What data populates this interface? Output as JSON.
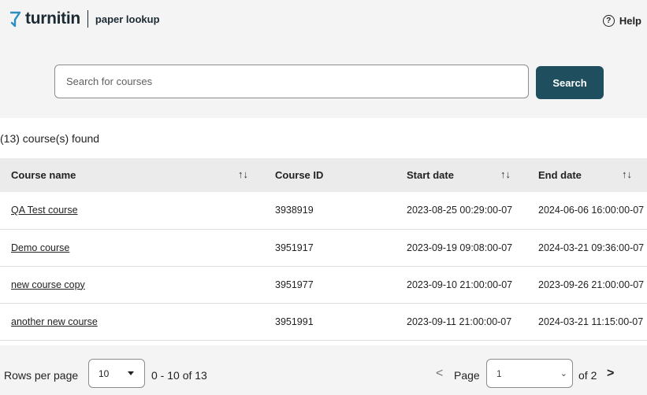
{
  "header": {
    "brand_name": "turnitin",
    "product_name": "paper lookup",
    "help_label": "Help",
    "help_icon": "question-circle-icon"
  },
  "search": {
    "placeholder": "Search for courses",
    "value": "",
    "button_label": "Search"
  },
  "results": {
    "count_text": "(13) course(s) found"
  },
  "table": {
    "columns": [
      {
        "label": "Course name",
        "sortable": true
      },
      {
        "label": "Course ID",
        "sortable": false
      },
      {
        "label": "Start date",
        "sortable": true
      },
      {
        "label": "End date",
        "sortable": true
      }
    ],
    "sort_glyph": "↑↓",
    "rows": [
      {
        "name": "QA Test course",
        "id": "3938919",
        "start": "2023-08-25 00:29:00-07",
        "end": "2024-06-06 16:00:00-07"
      },
      {
        "name": "Demo course",
        "id": "3951917",
        "start": "2023-09-19 09:08:00-07",
        "end": "2024-03-21 09:36:00-07"
      },
      {
        "name": "new course copy",
        "id": "3951977",
        "start": "2023-09-10 21:00:00-07",
        "end": "2023-09-26 21:00:00-07"
      },
      {
        "name": "another new course",
        "id": "3951991",
        "start": "2023-09-11 21:00:00-07",
        "end": "2024-03-21 11:15:00-07"
      }
    ]
  },
  "pagination": {
    "rows_per_page_label": "Rows per page",
    "rows_per_page_value": "10",
    "range_text": "0 - 10 of 13",
    "page_label": "Page",
    "page_value": "1",
    "of_pages_text": "of 2",
    "prev_glyph": "<",
    "next_glyph": ">"
  },
  "colors": {
    "accent": "#1f4e5f",
    "header_bg": "#f4f4f4",
    "table_header_bg": "#ebebeb",
    "brand_icon": "#2a8ec1"
  }
}
